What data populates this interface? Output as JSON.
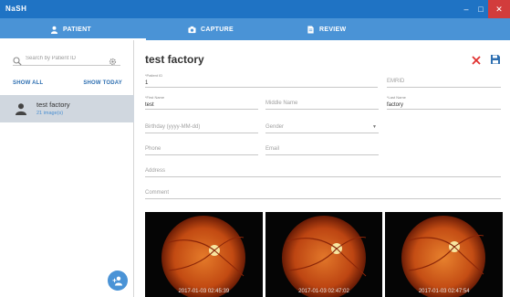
{
  "titlebar": {
    "app_name": "NaSH"
  },
  "tabs": [
    {
      "label": "PATIENT",
      "icon": "person-icon"
    },
    {
      "label": "CAPTURE",
      "icon": "camera-icon"
    },
    {
      "label": "REVIEW",
      "icon": "document-icon"
    }
  ],
  "sidebar": {
    "search_placeholder": "Search by Patient ID",
    "show_all": "SHOW ALL",
    "show_today": "SHOW TODAY",
    "patients": [
      {
        "name": "test factory",
        "subtitle": "21 image(s)"
      }
    ]
  },
  "main": {
    "title": "test factory",
    "fields": {
      "patient_id": {
        "label": "*Patient ID",
        "value": "1"
      },
      "emrid": {
        "placeholder": "EMRID"
      },
      "first_name": {
        "label": "*First Name",
        "value": "test"
      },
      "middle_name": {
        "placeholder": "Middle Name"
      },
      "last_name": {
        "label": "*Last Name",
        "value": "factory"
      },
      "birthday": {
        "placeholder": "Birthday (yyyy-MM-dd)"
      },
      "gender": {
        "placeholder": "Gender"
      },
      "phone": {
        "placeholder": "Phone"
      },
      "email": {
        "placeholder": "Email"
      },
      "address": {
        "placeholder": "Address"
      },
      "comment": {
        "placeholder": "Comment"
      }
    },
    "images": [
      {
        "timestamp": "2017-01-03 02:45:39"
      },
      {
        "timestamp": "2017-01-03 02:47:02"
      },
      {
        "timestamp": "2017-01-03 02:47:54"
      }
    ]
  },
  "colors": {
    "titlebar": "#1f73c4",
    "tabbar": "#4a93d6",
    "accent": "#2e6fb1",
    "close_red": "#e0312f"
  }
}
